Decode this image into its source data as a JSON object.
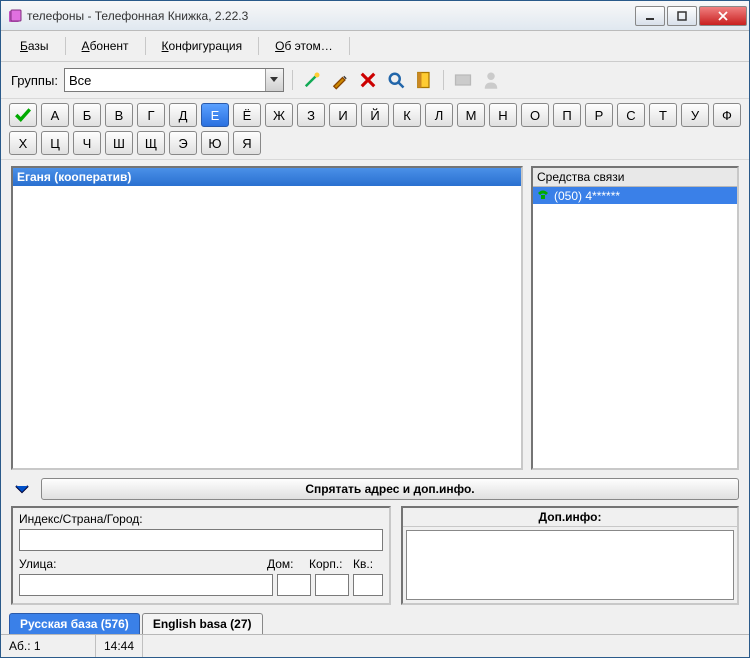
{
  "window": {
    "title": "телефоны - Телефонная Книжка, 2.22.3"
  },
  "menu": {
    "bases": "Базы",
    "abonent": "Абонент",
    "config": "Конфигурация",
    "about": "Об этом…"
  },
  "groups": {
    "label": "Группы:",
    "value": "Все"
  },
  "alphabet": {
    "row1": [
      "А",
      "Б",
      "В",
      "Г",
      "Д",
      "Е",
      "Ё",
      "Ж",
      "З",
      "И",
      "Й",
      "К",
      "Л",
      "М",
      "Н",
      "О",
      "П",
      "Р",
      "С"
    ],
    "row2": [
      "Т",
      "У",
      "Ф",
      "Х",
      "Ц",
      "Ч",
      "Ш",
      "Щ",
      "Э",
      "Ю",
      "Я"
    ],
    "selected": "Е"
  },
  "list": {
    "entry": "Еганя (кооператив)"
  },
  "comm": {
    "title": "Средства связи",
    "phone": "(050) 4******"
  },
  "hide": {
    "label": "Спрятать адрес и доп.инфо."
  },
  "addr": {
    "index_label": "Индекс/Страна/Город:",
    "street_label": "Улица:",
    "house_label": "Дом:",
    "korp_label": "Корп.:",
    "kv_label": "Кв.:",
    "dop_label": "Доп.инфо:"
  },
  "tabs": {
    "ru": "Русская база (576)",
    "en": "English basa (27)"
  },
  "status": {
    "ab": "Аб.: 1",
    "time": "14:44"
  }
}
